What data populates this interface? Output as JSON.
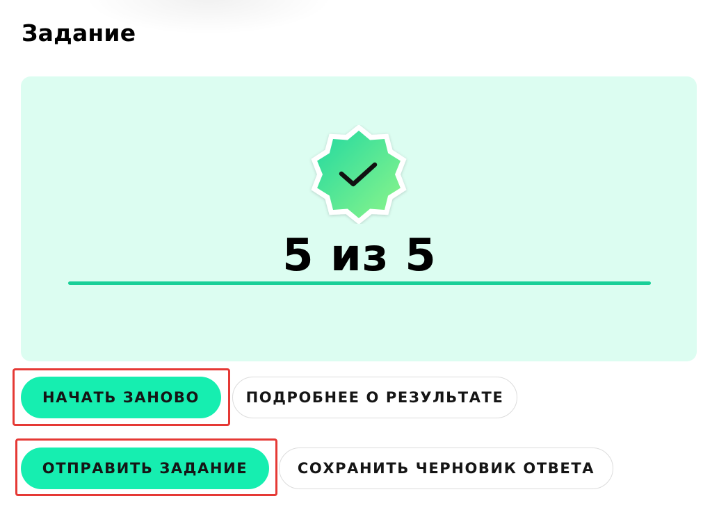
{
  "page": {
    "title": "Задание"
  },
  "result": {
    "score_text": "5 из 5",
    "score": 5,
    "max_score": 5,
    "progress_fraction": 1.0,
    "badge_icon": "check-badge-icon"
  },
  "actions": {
    "restart_label": "НАЧАТЬ ЗАНОВО",
    "details_label": "ПОДРОБНЕЕ О РЕЗУЛЬТАТЕ",
    "submit_label": "ОТПРАВИТЬ ЗАДАНИЕ",
    "save_draft_label": "СОХРАНИТЬ ЧЕРНОВИК ОТВЕТА"
  },
  "colors": {
    "card_background": "#dcfdf1",
    "accent": "#16eeb0",
    "progress": "#19cf98",
    "highlight_border": "#e53935"
  }
}
